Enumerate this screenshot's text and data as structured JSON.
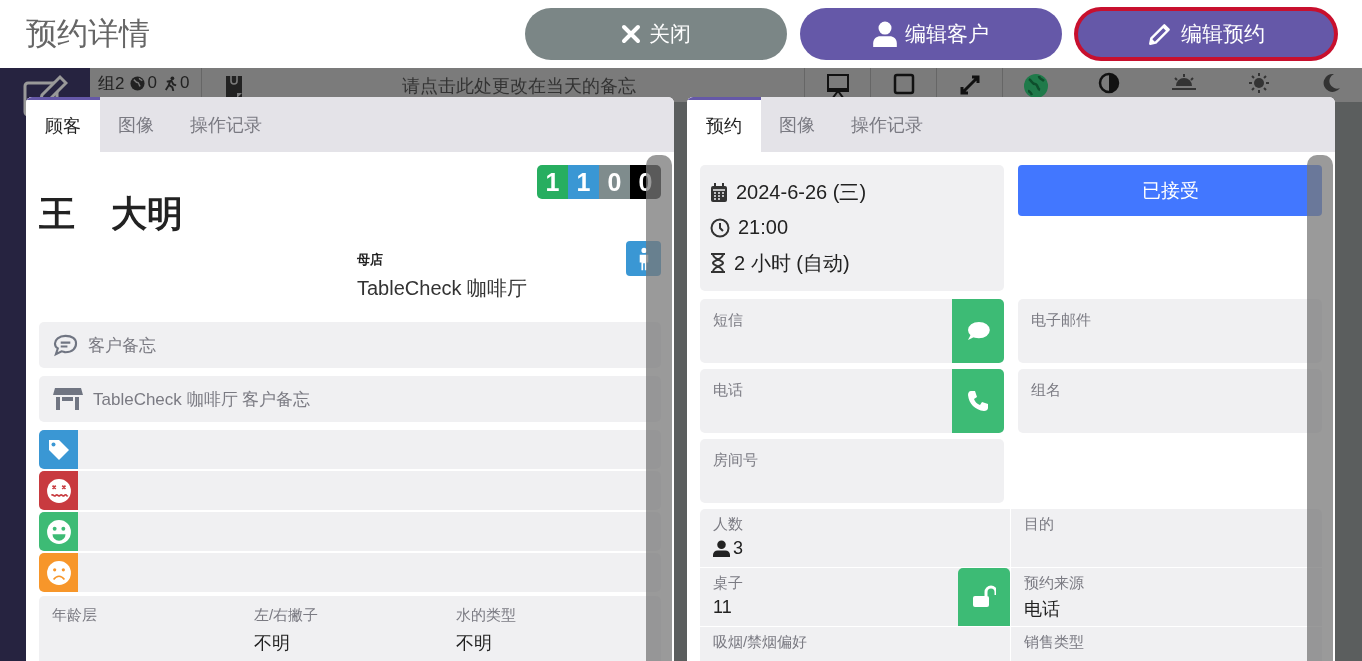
{
  "header": {
    "title": "预约详情",
    "buttons": [
      {
        "label": "关闭",
        "kind": "close",
        "focused": false
      },
      {
        "label": "编辑客户",
        "kind": "customer",
        "focused": false
      },
      {
        "label": "编辑预约",
        "kind": "edit",
        "focused": true
      }
    ]
  },
  "background": {
    "counts": [
      {
        "kind": "group",
        "label": "组",
        "value": "2"
      },
      {
        "kind": "globe",
        "value": "0"
      },
      {
        "kind": "walk",
        "value": "0"
      }
    ],
    "memo": "请点击此处更改在当天的备忘"
  },
  "customer_panel": {
    "tabs": [
      {
        "label": "顾客",
        "selected": true
      },
      {
        "label": "图像",
        "selected": false
      },
      {
        "label": "操作记录",
        "selected": false
      }
    ],
    "visit_counts": [
      {
        "value": "1",
        "color": "#27ae60"
      },
      {
        "value": "1",
        "color": "#3a97d4"
      },
      {
        "value": "0",
        "color": "#7f8c8d"
      },
      {
        "value": "0",
        "color": "#000000"
      }
    ],
    "name": "王　大明",
    "home_store_label": "母店",
    "home_store": "TableCheck 咖啡厅",
    "notes": [
      {
        "kind": "chat",
        "label": "客户备忘"
      },
      {
        "kind": "store",
        "label": "TableCheck 咖啡厅 客户备忘"
      }
    ],
    "tags": [
      {
        "kind": "tag",
        "color": "#3a97d4"
      },
      {
        "kind": "dizzy",
        "color": "#c83a3f"
      },
      {
        "kind": "smile",
        "color": "#3dbb75"
      },
      {
        "kind": "frown",
        "color": "#f7962a"
      }
    ],
    "attributes": [
      {
        "label": "年龄层"
      },
      {
        "label": "左/右撇子",
        "value": "不明"
      },
      {
        "label": "水的类型",
        "value": "不明"
      }
    ]
  },
  "reservation_panel": {
    "tabs": [
      {
        "label": "预约",
        "selected": true
      },
      {
        "label": "图像",
        "selected": false
      },
      {
        "label": "操作记录",
        "selected": false
      }
    ],
    "date": "2024-6-26 (三)",
    "time": "21:00",
    "duration": "2 小时 (自动)",
    "status": "已接受",
    "contact_fields": [
      {
        "label": "短信",
        "kind": "message"
      },
      {
        "label": "电子邮件"
      },
      {
        "label": "电话",
        "kind": "phone"
      },
      {
        "label": "组名"
      },
      {
        "label": "房间号"
      }
    ],
    "details": [
      {
        "label": "人数",
        "value": "3",
        "kind": "party"
      },
      {
        "label": "目的"
      },
      {
        "label": "桌子",
        "value": "11",
        "kind": "table",
        "locked": false
      },
      {
        "label": "预约来源",
        "value": "电话"
      },
      {
        "label": "吸烟/禁烟偏好"
      },
      {
        "label": "销售类型"
      }
    ]
  }
}
